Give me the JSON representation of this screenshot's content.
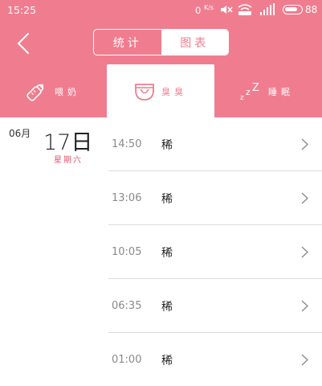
{
  "status_bar": {
    "time": "15:25",
    "net_speed": "0",
    "net_unit": "K/s",
    "battery": "88"
  },
  "toolbar": {
    "segments": [
      "统计",
      "图表"
    ]
  },
  "tabs": [
    {
      "label": "喂奶",
      "icon": "baby-bottle-icon"
    },
    {
      "label": "臭臭",
      "icon": "diaper-icon"
    },
    {
      "label": "睡眠",
      "icon": "sleep-zzz-icon"
    }
  ],
  "date": {
    "month": "06月",
    "day": "17日",
    "weekday": "星期六"
  },
  "records": [
    {
      "time": "14:50",
      "status": "稀"
    },
    {
      "time": "13:06",
      "status": "稀"
    },
    {
      "time": "10:05",
      "status": "稀"
    },
    {
      "time": "06:35",
      "status": "稀"
    },
    {
      "time": "01:00",
      "status": "稀"
    }
  ],
  "colors": {
    "accent": "#f07d8f",
    "weekday": "#e0566f"
  }
}
